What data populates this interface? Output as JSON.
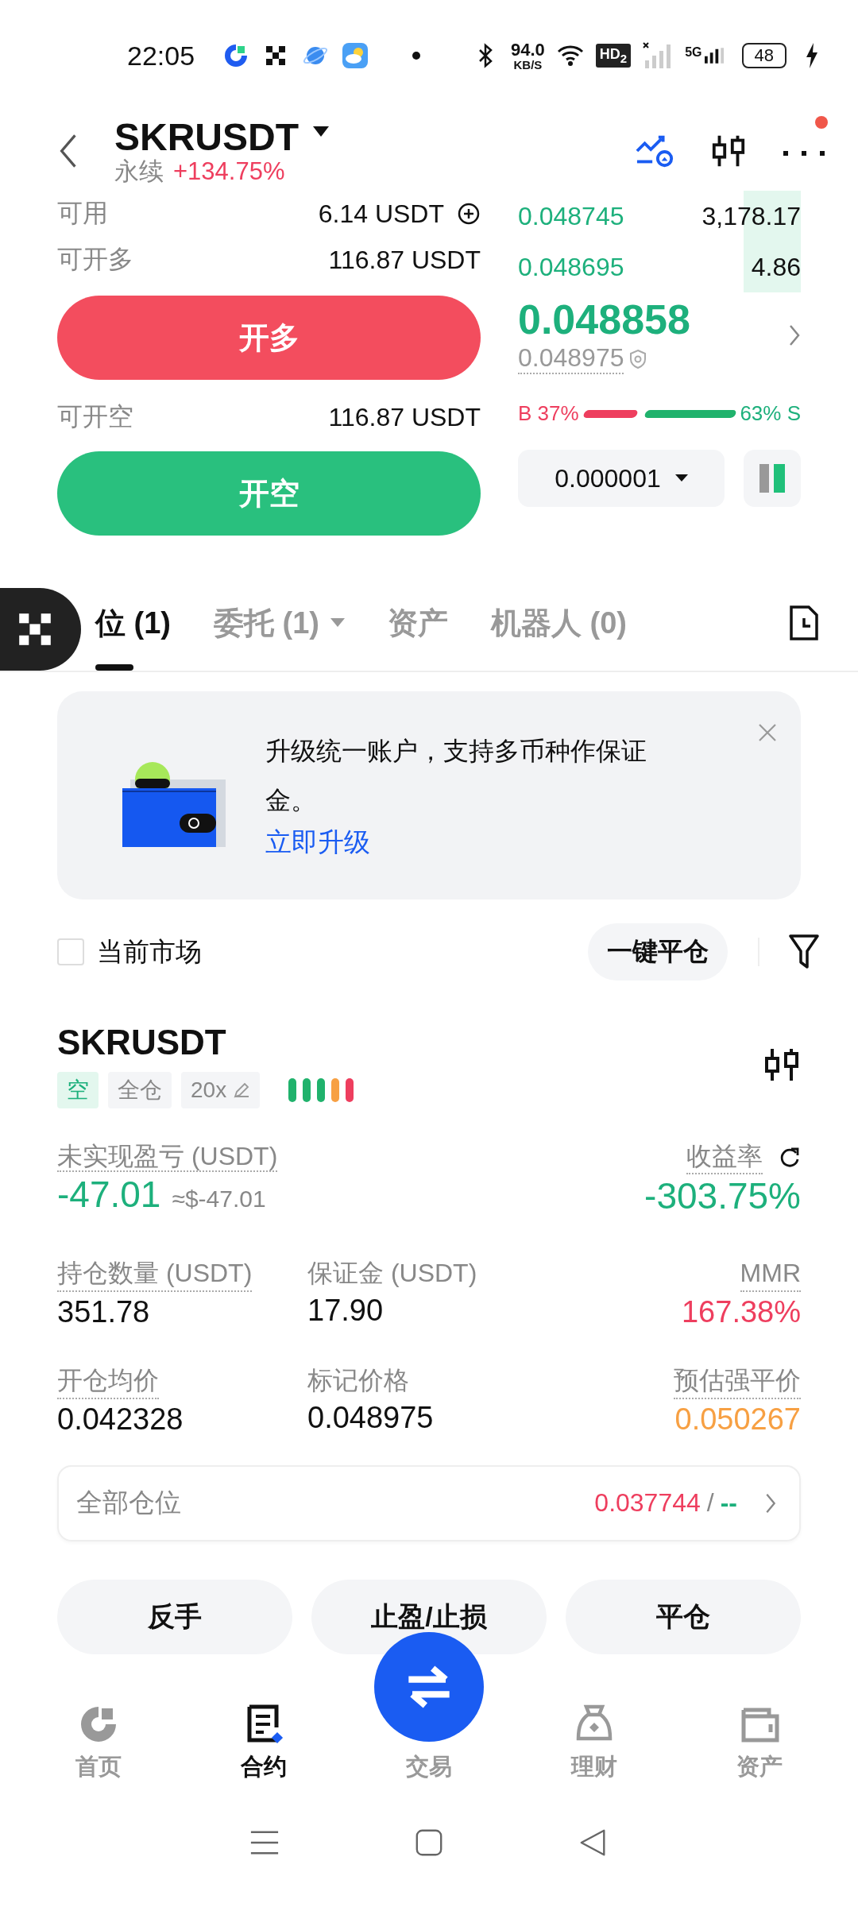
{
  "status_bar": {
    "time": "22:05",
    "net_speed": "94.0",
    "net_unit": "KB/S",
    "hd": "HD$_{2}$",
    "network": "5G",
    "battery": "48"
  },
  "header": {
    "symbol": "SKRUSDT",
    "type": "永续",
    "change": "+134.75%",
    "notification_dot": true
  },
  "order": {
    "available_label": "可用",
    "available_value": "6.14 USDT",
    "long_label": "可开多",
    "long_value": "116.87 USDT",
    "long_button": "开多",
    "short_label": "可开空",
    "short_value": "116.87 USDT",
    "short_button": "开空"
  },
  "orderbook": {
    "rows": [
      {
        "price": "0.048745",
        "size": "3,178.17"
      },
      {
        "price": "0.048695",
        "size": "4.86"
      }
    ],
    "last_price": "0.048858",
    "mark_price": "0.048975",
    "buy_label": "B 37%",
    "sell_label": "63% S",
    "precision": "0.000001"
  },
  "tabs": [
    {
      "label": "位 (1)",
      "selected": true,
      "dropdown": false
    },
    {
      "label": "委托 (1)",
      "selected": false,
      "dropdown": true
    },
    {
      "label": "资产",
      "selected": false,
      "dropdown": false
    },
    {
      "label": "机器人 (0)",
      "selected": false,
      "dropdown": false
    }
  ],
  "banner": {
    "text": "升级统一账户，支持多币种作保证金。",
    "link": "立即升级"
  },
  "filter": {
    "label": "当前市场",
    "checked": false,
    "close_all": "一键平仓"
  },
  "position": {
    "symbol": "SKRUSDT",
    "tags": [
      {
        "label": "空",
        "kind": "side"
      },
      {
        "label": "全仓",
        "kind": "mode"
      },
      {
        "label": "20x",
        "kind": "leverage"
      }
    ],
    "risk_bars": [
      {
        "color": "#20b26c"
      },
      {
        "color": "#20b26c"
      },
      {
        "color": "#20b26c"
      },
      {
        "color": "#f7a043"
      },
      {
        "color": "#ee3e5e"
      }
    ],
    "pnl_label": "未实现盈亏 (USDT)",
    "pnl_value": "-47.01",
    "pnl_approx": "≈$-47.01",
    "roe_label": "收益率",
    "roe_value": "-303.75%",
    "metrics": [
      {
        "label": "持仓数量 (USDT)",
        "value": "351.78",
        "color": "#111111",
        "dotted": true
      },
      {
        "label": "保证金 (USDT)",
        "value": "17.90",
        "color": "#111111",
        "dotted": false
      },
      {
        "label": "MMR",
        "value": "167.38%",
        "color": "#ee3e5e",
        "dotted": true
      },
      {
        "label": "开仓均价",
        "value": "0.042328",
        "color": "#111111",
        "dotted": true
      },
      {
        "label": "标记价格",
        "value": "0.048975",
        "color": "#111111",
        "dotted": false
      },
      {
        "label": "预估强平价",
        "value": "0.050267",
        "color": "#f7a043",
        "dotted": true
      }
    ],
    "all_label": "全部仓位",
    "tp": "0.037744",
    "separator": "/",
    "sl": "--"
  },
  "actions": [
    "反手",
    "止盈/止损",
    "平仓"
  ],
  "nav": [
    {
      "label": "首页",
      "kind": "home",
      "selected": false
    },
    {
      "label": "合约",
      "kind": "contract",
      "selected": true
    },
    {
      "label": "交易",
      "kind": "trade",
      "selected": false
    },
    {
      "label": "理财",
      "kind": "earn",
      "selected": false
    },
    {
      "label": "资产",
      "kind": "assets",
      "selected": false
    }
  ]
}
